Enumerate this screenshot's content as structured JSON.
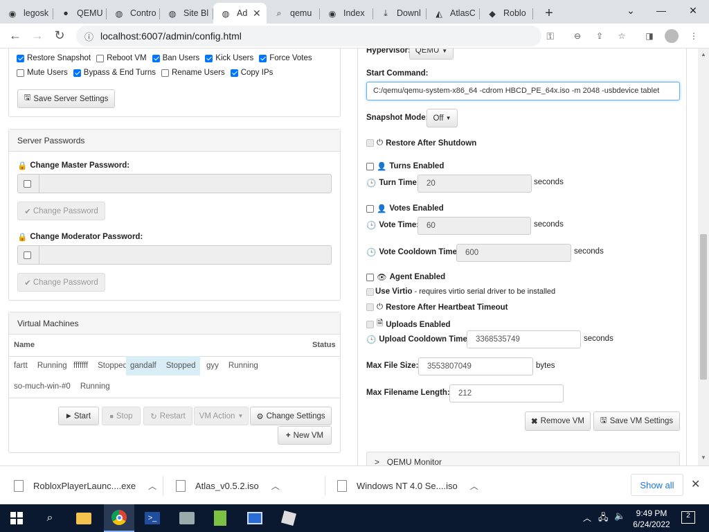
{
  "browser": {
    "tabs": [
      {
        "label": "legosk",
        "icon": "github-icon"
      },
      {
        "label": "QEMU",
        "icon": "qemu-icon"
      },
      {
        "label": "Contro",
        "icon": "globe-icon"
      },
      {
        "label": "Site Bl",
        "icon": "globe-icon"
      },
      {
        "label": "Ad",
        "icon": "globe-icon"
      },
      {
        "label": "qemu",
        "icon": "search-icon"
      },
      {
        "label": "Index",
        "icon": "github-icon"
      },
      {
        "label": "Downl",
        "icon": "download-icon"
      },
      {
        "label": "AtlasC",
        "icon": "atlas-icon"
      },
      {
        "label": "Roblo",
        "icon": "roblox-icon"
      }
    ],
    "new_tab": "+",
    "url": "localhost:6007/admin/config.html"
  },
  "settings": {
    "checkboxes_row1": [
      {
        "label": "Restore Snapshot",
        "checked": true
      },
      {
        "label": "Reboot VM",
        "checked": false
      },
      {
        "label": "Ban Users",
        "checked": true
      },
      {
        "label": "Kick Users",
        "checked": true
      },
      {
        "label": "Force Votes",
        "checked": true
      }
    ],
    "checkboxes_row2": [
      {
        "label": "Mute Users",
        "checked": false
      },
      {
        "label": "Bypass & End Turns",
        "checked": true
      },
      {
        "label": "Rename Users",
        "checked": false
      },
      {
        "label": "Copy IPs",
        "checked": true
      }
    ],
    "save_server_settings": "Save Server Settings"
  },
  "passwords": {
    "title": "Server Passwords",
    "master_label": "Change Master Password:",
    "moderator_label": "Change Moderator Password:",
    "change_password": "Change Password"
  },
  "vms": {
    "title": "Virtual Machines",
    "col_name": "Name",
    "col_status": "Status",
    "rows": [
      {
        "name": "fartt",
        "status": "Running"
      },
      {
        "name": "fffffff",
        "status": "Stopped"
      },
      {
        "name": "gandalf",
        "status": "Stopped"
      },
      {
        "name": "gyy",
        "status": "Running"
      },
      {
        "name": "so-much-win-#0",
        "status": "Running"
      }
    ],
    "start": "Start",
    "stop": "Stop",
    "restart": "Restart",
    "vm_action": "VM Action",
    "change_settings": "Change Settings",
    "new_vm": "New VM"
  },
  "vmconfig": {
    "hypervisor_label": "Hypervisor:",
    "hypervisor_value": "QEMU",
    "start_command_label": "Start Command:",
    "start_command_value": "C:/qemu/qemu-system-x86_64 -cdrom HBCD_PE_64x.iso -m 2048 -usbdevice tablet",
    "snapshot_mode_label": "Snapshot Mode:",
    "snapshot_mode_value": "Off",
    "restore_after_shutdown": "Restore After Shutdown",
    "turns_enabled": "Turns Enabled",
    "turn_time_label": "Turn Time:",
    "turn_time_value": "20",
    "votes_enabled": "Votes Enabled",
    "vote_time_label": "Vote Time:",
    "vote_time_value": "60",
    "vote_cooldown_label": "Vote Cooldown Time:",
    "vote_cooldown_value": "600",
    "seconds": "seconds",
    "agent_enabled": "Agent Enabled",
    "use_virtio_bold": "Use Virtio",
    "use_virtio_rest": " - requires virtio serial driver to be installed",
    "restore_after_heartbeat": "Restore After Heartbeat Timeout",
    "uploads_enabled": "Uploads Enabled",
    "upload_cooldown_label": "Upload Cooldown Time:",
    "upload_cooldown_value": "3368535749",
    "max_file_size_label": "Max File Size:",
    "max_file_size_value": "3553807049",
    "bytes": "bytes",
    "max_filename_label": "Max Filename Length:",
    "max_filename_value": "212",
    "remove_vm": "Remove VM",
    "save_vm_settings": "Save VM Settings",
    "qemu_monitor": "QEMU Monitor"
  },
  "downloads": {
    "items": [
      "RobloxPlayerLaunc....exe",
      "Atlas_v0.5.2.iso",
      "Windows NT 4.0 Se....iso"
    ],
    "show_all": "Show all"
  },
  "taskbar": {
    "time": "9:49 PM",
    "date": "6/24/2022",
    "notifications": "2"
  }
}
